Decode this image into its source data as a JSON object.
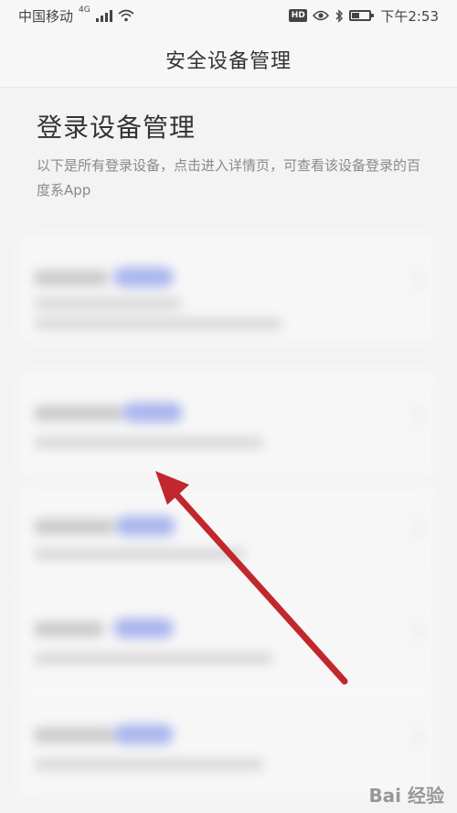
{
  "status_bar": {
    "carrier": "中国移动",
    "network": "4G",
    "time": "下午2:53",
    "hd_badge": "HD",
    "battery_level": 0.45,
    "icons": [
      "signal-icon",
      "wifi-icon",
      "hd-icon",
      "eye-icon",
      "bluetooth-icon",
      "battery-icon"
    ]
  },
  "header": {
    "title": "安全设备管理"
  },
  "main": {
    "heading": "登录设备管理",
    "description": "以下是所有登录设备，点击进入详情页，可查看该设备登录的百度系App"
  },
  "annotation": {
    "arrow_color": "#c0282d"
  },
  "watermark": {
    "text": "Bai 经验"
  }
}
